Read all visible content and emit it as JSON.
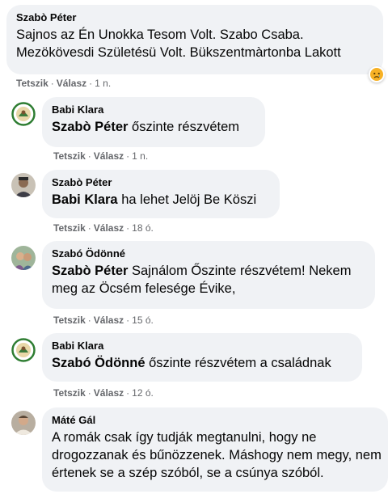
{
  "comments": [
    {
      "author": "Szabò Péter",
      "mention": "",
      "text": "Sajnos az Én Unokka Tesom Volt. Szabo Csaba. Mezökövesdi Születésü Volt. Bükszentmàrtonba Lakott",
      "like_label": "Tetszik",
      "reply_label": "Válasz",
      "time": "1 n.",
      "reaction_icon": "sad-emoji-icon"
    },
    {
      "author": "Babi Klara",
      "mention": "Szabò Péter",
      "text": "őszinte részvétem",
      "like_label": "Tetszik",
      "reply_label": "Válasz",
      "time": "1 n.",
      "avatar_icon": "avatar-green-emblem"
    },
    {
      "author": "Szabò Péter",
      "mention": "Babi Klara",
      "text": "ha lehet Jelöj Be Köszi",
      "like_label": "Tetszik",
      "reply_label": "Válasz",
      "time": "18 ó.",
      "avatar_icon": "avatar-photo"
    },
    {
      "author": "Szabó Ödönné",
      "mention": "Szabò Péter",
      "text": "Sajnálom Őszinte részvétem! Nekem meg az Öcsém felesége Évike,",
      "like_label": "Tetszik",
      "reply_label": "Válasz",
      "time": "15 ó.",
      "avatar_icon": "avatar-photo"
    },
    {
      "author": "Babi Klara",
      "mention": "Szabó Ödönné",
      "text": "őszinte részvétem a családnak",
      "like_label": "Tetszik",
      "reply_label": "Válasz",
      "time": "12 ó.",
      "avatar_icon": "avatar-green-emblem"
    },
    {
      "author": "Máté Gál",
      "mention": "",
      "text": "A romák csak így tudják megtanulni, hogy ne drogozzanak és bűnözzenek. Máshogy nem megy, nem értenek se a szép szóból, se a csúnya szóból.",
      "avatar_icon": "avatar-photo"
    }
  ],
  "colors": {
    "bubble": "#f0f2f5",
    "meta": "#65676b",
    "text": "#050505"
  }
}
